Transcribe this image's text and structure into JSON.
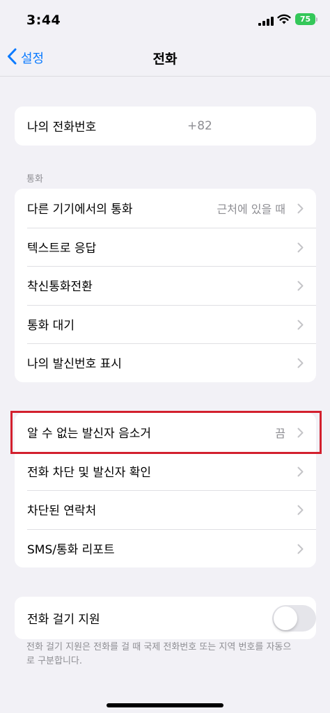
{
  "status_bar": {
    "time": "3:44",
    "battery": "75",
    "battery_color": "#34c759"
  },
  "nav": {
    "back_label": "설정",
    "title": "전화",
    "accent_color": "#0a7aff"
  },
  "my_number": {
    "label": "나의 전화번호",
    "value": "+82"
  },
  "calls_section": {
    "header": "통화",
    "items": [
      {
        "label": "다른 기기에서의 통화",
        "value": "근처에 있을 때"
      },
      {
        "label": "텍스트로 응답"
      },
      {
        "label": "착신통화전환"
      },
      {
        "label": "통화 대기"
      },
      {
        "label": "나의 발신번호 표시"
      }
    ]
  },
  "block_section": {
    "items": [
      {
        "label": "알 수 없는 발신자 음소거",
        "value": "끔",
        "highlighted": true
      },
      {
        "label": "전화 차단 및 발신자 확인"
      },
      {
        "label": "차단된 연락처"
      },
      {
        "label": "SMS/통화 리포트"
      }
    ]
  },
  "dial_assist": {
    "label": "전화 걸기 지원",
    "enabled": false,
    "footer": "전화 걸기 지원은 전화를 걸 때 국제 전화번호 또는 지역 번호를 자동으로 구분합니다."
  },
  "icons": [
    "cellular-signal-icon",
    "wifi-icon",
    "battery-icon",
    "back-chevron-icon",
    "chevron-right-icon"
  ]
}
